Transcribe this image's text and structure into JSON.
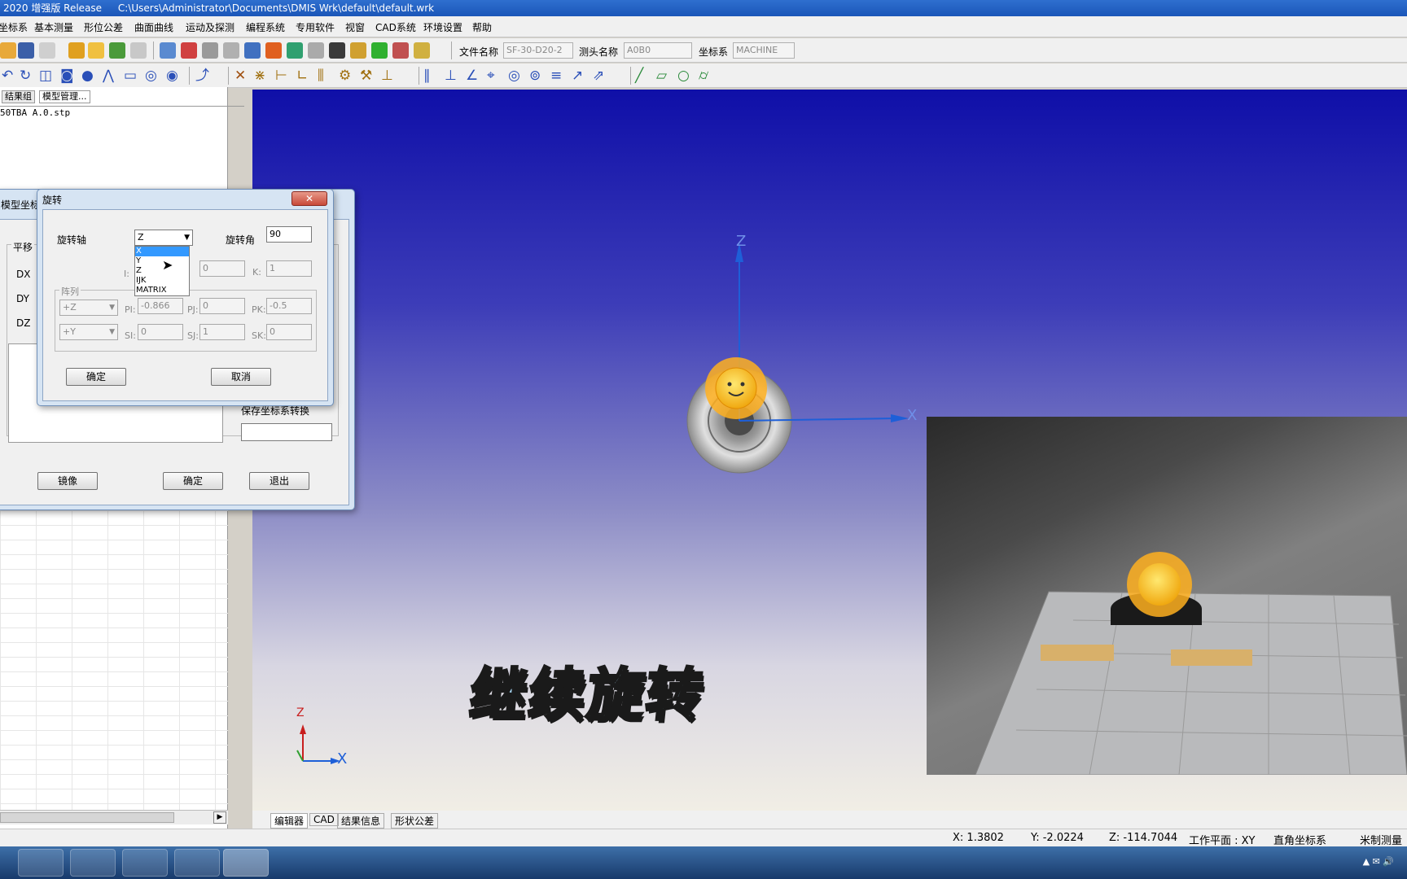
{
  "titlebar": {
    "app": "2020 增强版 Release",
    "path": "C:\\Users\\Administrator\\Documents\\DMIS Wrk\\default\\default.wrk"
  },
  "menu": [
    "坐标系",
    "基本测量",
    "形位公差",
    "曲面曲线",
    "运动及探测",
    "编程系统",
    "专用软件",
    "视窗",
    "CAD系统",
    "环境设置",
    "帮助"
  ],
  "toolbar": {
    "file_label": "文件名称",
    "file_value": "SF-30-D20-2",
    "probe_label": "测头名称",
    "probe_value": "A0B0",
    "coord_label": "坐标系",
    "coord_value": "MACHINE"
  },
  "left_panel": {
    "tabs": [
      "结果组",
      "模型管理..."
    ],
    "file": "50TBA A.0.stp"
  },
  "bg_dialog": {
    "title": "模型坐标",
    "translate_group": "平移",
    "dx": "DX",
    "dy": "DY",
    "dz": "DZ",
    "save_label": "保存坐标系转换",
    "mirror": "镜像",
    "ok": "确定",
    "exit": "退出"
  },
  "rot_dialog": {
    "title": "旋转",
    "axis_label": "旋转轴",
    "axis_value": "Z",
    "angle_label": "旋转角",
    "angle_value": "90",
    "i_label": "I:",
    "j_value": "0",
    "k_label": "K:",
    "k_value": "1",
    "matrix_group": "阵列",
    "pz_sel": "+Z",
    "py_sel": "+Y",
    "pi_label": "PI:",
    "pi_value": "-0.866",
    "pj_label": "PJ:",
    "pj_value": "0",
    "pk_label": "PK:",
    "pk_value": "-0.5",
    "si_label": "SI:",
    "si_value": "0",
    "sj_label": "SJ:",
    "sj_value": "1",
    "sk_label": "SK:",
    "sk_value": "0",
    "ok": "确定",
    "cancel": "取消",
    "dropdown_options": [
      "X",
      "Y",
      "Z",
      "IJK",
      "MATRIX"
    ]
  },
  "viewport": {
    "axis_z": "Z",
    "axis_x": "X",
    "triad_z": "Z",
    "triad_x": "X",
    "caption": "继续旋转"
  },
  "bottom_tabs": [
    "编辑器",
    "CAD",
    "结果信息",
    "形状公差"
  ],
  "status": {
    "x": "X: 1.3802",
    "y": "Y: -2.0224",
    "z": "Z: -114.7044",
    "plane": "工作平面 : XY",
    "coord": "直角坐标系",
    "unit": "米制测量"
  },
  "colors": {
    "accent": "#1b56b8",
    "axis": "#1e5fd8",
    "axis_red": "#c81e1e"
  }
}
